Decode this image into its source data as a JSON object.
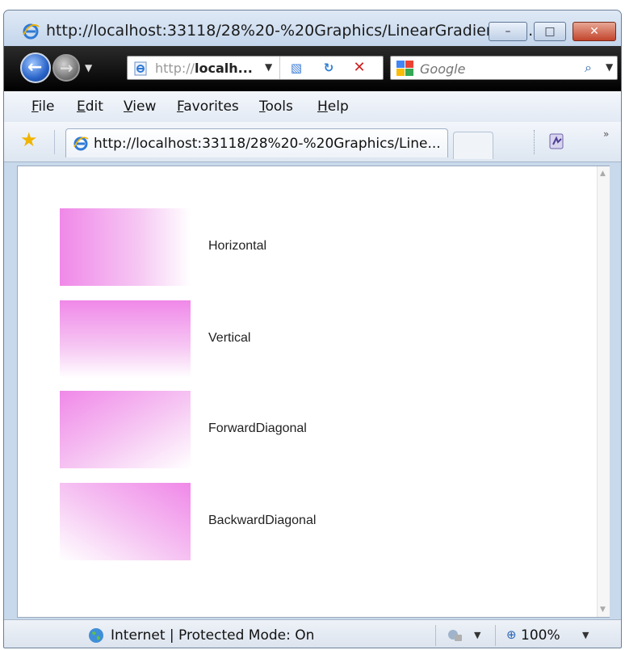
{
  "window": {
    "title": "http://localhost:33118/28%20-%20Graphics/LinearGradientBru...",
    "minimize_label": "–",
    "maximize_label": "□",
    "close_label": "✕"
  },
  "address_bar": {
    "prefix": "http://",
    "host": "localh...",
    "dropdown_label": "▼"
  },
  "search": {
    "placeholder": "Google",
    "engine_icon": "google-icon",
    "button_icon": "magnifier-icon"
  },
  "menu": {
    "items": [
      "File",
      "Edit",
      "View",
      "Favorites",
      "Tools",
      "Help"
    ]
  },
  "tab": {
    "title": "http://localhost:33118/28%20-%20Graphics/Line..."
  },
  "page": {
    "samples": [
      {
        "label": "Horizontal",
        "mode": "horizontal"
      },
      {
        "label": "Vertical",
        "mode": "vertical"
      },
      {
        "label": "ForwardDiagonal",
        "mode": "forward-diagonal"
      },
      {
        "label": "BackwardDiagonal",
        "mode": "backward-diagonal"
      }
    ],
    "gradient_colors": [
      "#f088e8",
      "#ffffff"
    ]
  },
  "status": {
    "zone": "Internet | Protected Mode: On",
    "zoom": "100%"
  }
}
